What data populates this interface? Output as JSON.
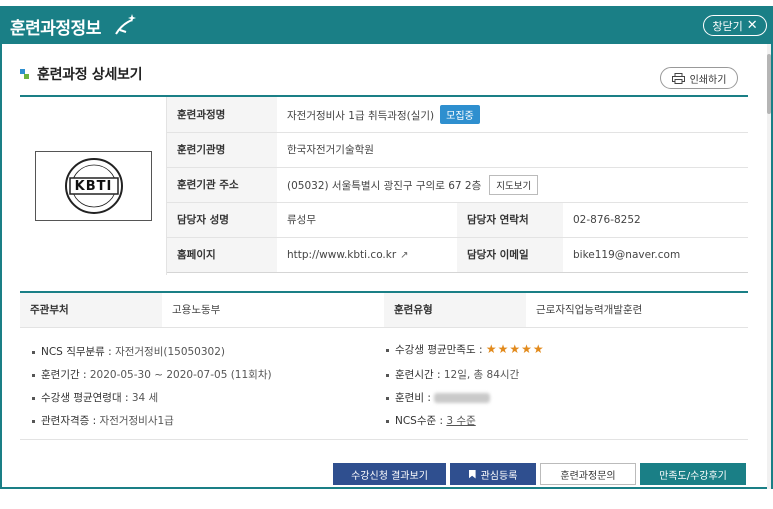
{
  "window": {
    "title": "훈련과정정보",
    "close_label": "창닫기"
  },
  "section": {
    "title": "훈련과정 상세보기"
  },
  "print_label": "인쇄하기",
  "logo_text": "KBTI",
  "detail": {
    "course_name_label": "훈련과정명",
    "course_name": "자전거정비사 1급 취득과정(실기)",
    "status_badge": "모집중",
    "institution_label": "훈련기관명",
    "institution": "한국자전거기술학원",
    "address_label": "훈련기관 주소",
    "address": "(05032) 서울특별시 광진구 구의로 67 2층",
    "map_button": "지도보기",
    "contact_name_label": "담당자 성명",
    "contact_name": "류성무",
    "contact_phone_label": "담당자 연락처",
    "contact_phone": "02-876-8252",
    "homepage_label": "홈페이지",
    "homepage": "http://www.kbti.co.kr",
    "contact_email_label": "담당자 이메일",
    "contact_email": "bike119@naver.com"
  },
  "summary": {
    "ministry_label": "주관부처",
    "ministry": "고용노동부",
    "type_label": "훈련유형",
    "type": "근로자직업능력개발훈련"
  },
  "facts": {
    "ncs_label": "NCS 직무분류 :",
    "ncs_value": "자전거정비(15050302)",
    "satisfaction_label": "수강생 평균만족도 :",
    "satisfaction_stars": "★★★★★",
    "period_label": "훈련기간 :",
    "period_value": "2020-05-30 ~ 2020-07-05 (11회차)",
    "hours_label": "훈련시간 :",
    "hours_value": "12일, 총 84시간",
    "age_label": "수강생 평균연령대 :",
    "age_value": "34 세",
    "fee_label": "훈련비 :",
    "cert_label": "관련자격증 :",
    "cert_value": "자전거정비사1급",
    "ncs_level_label": "NCS수준 :",
    "ncs_level_value": "3 수준"
  },
  "actions": {
    "results": "수강신청 결과보기",
    "favorite": "관심등록",
    "inquiry": "훈련과정문의",
    "review": "만족도/수강후기"
  }
}
